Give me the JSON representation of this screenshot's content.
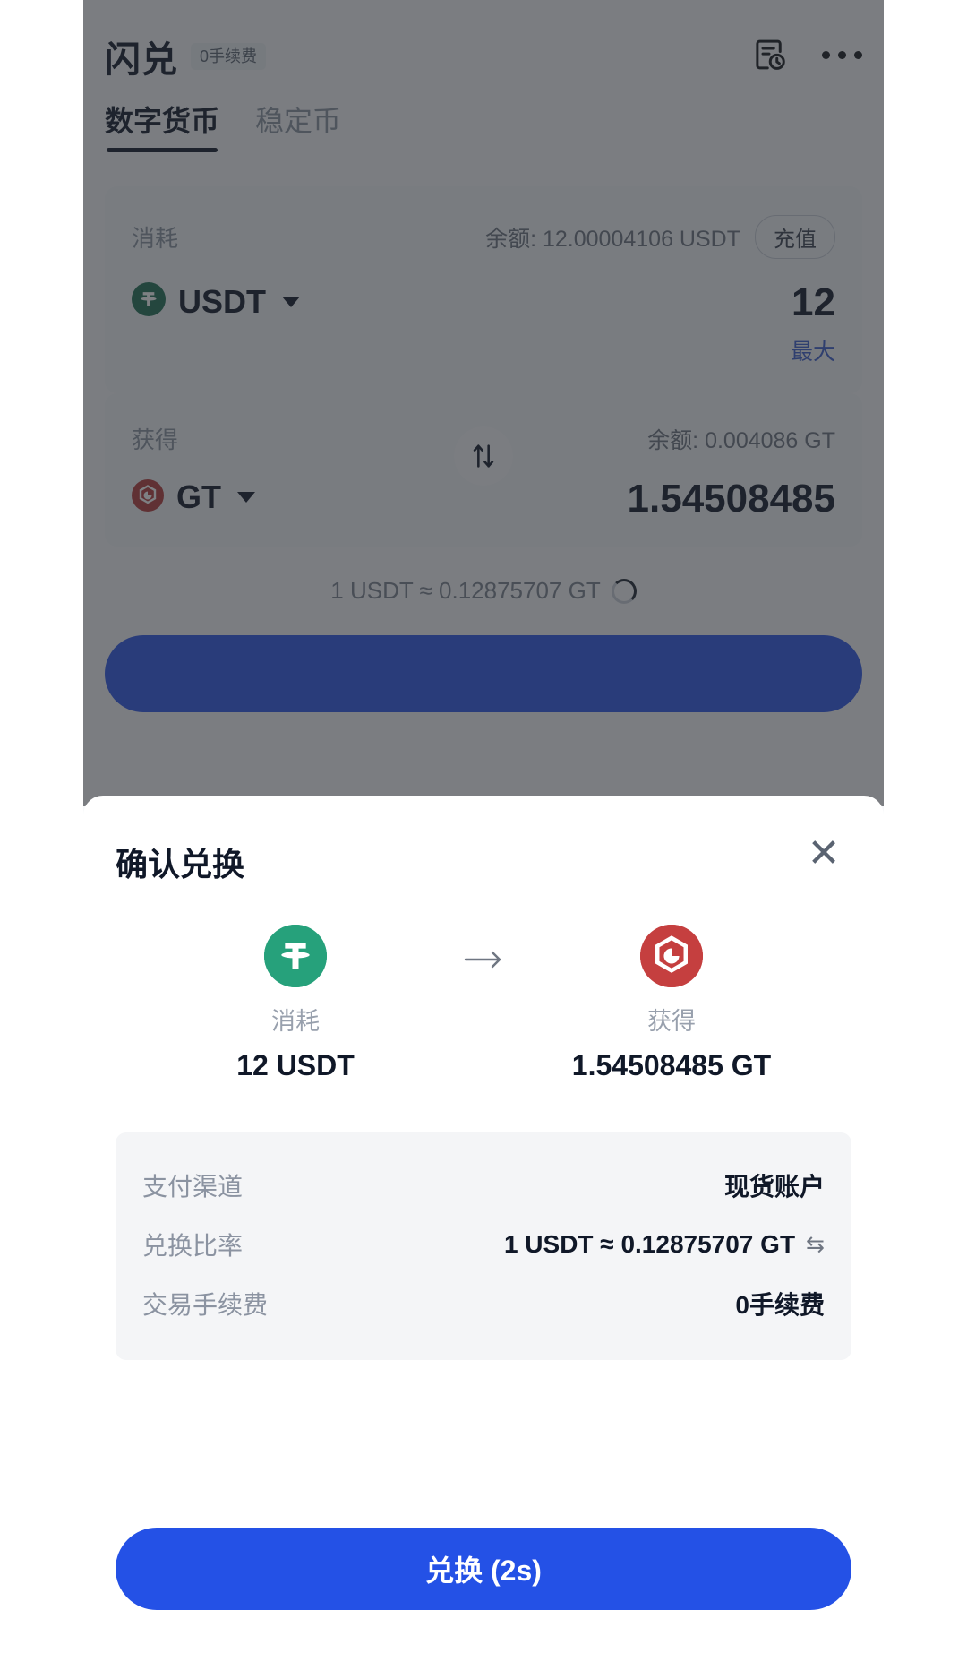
{
  "background_app": {
    "header": {
      "title": "闪兑",
      "fee_badge": "0手续费",
      "history_icon": "document-clock-icon",
      "more_icon": "more-dots-icon"
    },
    "tabs": [
      {
        "label": "数字货币",
        "active": true
      },
      {
        "label": "稳定币",
        "active": false
      }
    ],
    "from_section": {
      "side_label": "消耗",
      "balance": "余额: 12.00004106 USDT",
      "deposit_button": "充值",
      "coin": "USDT",
      "coin_icon": "usdt-token-icon",
      "amount": "12",
      "max_link": "最大"
    },
    "swap_toggle_icon": "swap-vertical-icon",
    "to_section": {
      "side_label": "获得",
      "balance": "余额: 0.004086 GT",
      "coin": "GT",
      "coin_icon": "gt-token-icon",
      "amount": "1.54508485"
    },
    "rate_line": "1 USDT ≈ 0.12875707 GT",
    "rate_spinner_icon": "loading-spinner-icon"
  },
  "modal": {
    "title": "确认兑换",
    "close_icon": "close-icon",
    "arrow_icon": "arrow-right-icon",
    "from_token": {
      "icon": "usdt-token-icon",
      "side_label": "消耗",
      "value": "12 USDT"
    },
    "to_token": {
      "icon": "gt-token-icon",
      "side_label": "获得",
      "value": "1.54508485 GT"
    },
    "details": [
      {
        "key": "支付渠道",
        "value": "现货账户",
        "icon": ""
      },
      {
        "key": "兑换比率",
        "value": "1 USDT ≈ 0.12875707 GT",
        "icon": "swap-horizontal-icon"
      },
      {
        "key": "交易手续费",
        "value": "0手续费",
        "icon": ""
      }
    ],
    "confirm_button": "兑换 (2s)"
  },
  "colors": {
    "primary_blue": "#2451e6",
    "usdt_green": "#26a17b",
    "gt_red": "#c53f3f",
    "max_link_blue": "#3a5ccc"
  }
}
